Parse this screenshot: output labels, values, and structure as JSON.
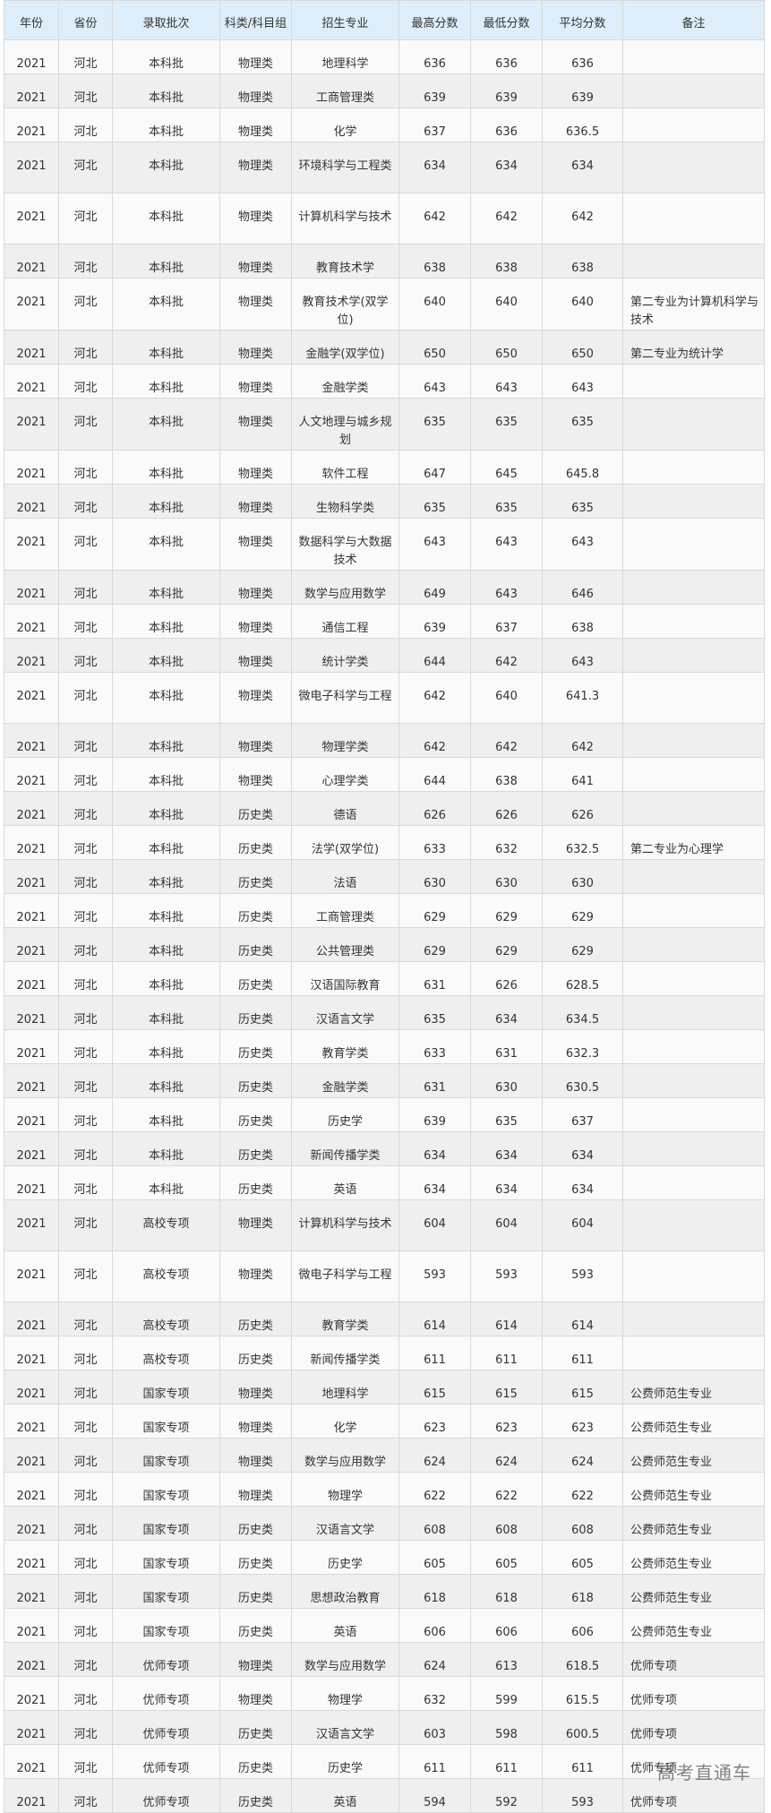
{
  "table": {
    "headers": [
      "年份",
      "省份",
      "录取批次",
      "科类/科目组",
      "招生专业",
      "最高分数",
      "最低分数",
      "平均分数",
      "备注"
    ],
    "rows": [
      [
        "2021",
        "河北",
        "本科批",
        "物理类",
        "地理科学",
        "636",
        "636",
        "636",
        ""
      ],
      [
        "2021",
        "河北",
        "本科批",
        "物理类",
        "工商管理类",
        "639",
        "639",
        "639",
        ""
      ],
      [
        "2021",
        "河北",
        "本科批",
        "物理类",
        "化学",
        "637",
        "636",
        "636.5",
        ""
      ],
      [
        "2021",
        "河北",
        "本科批",
        "物理类",
        "环境科学与工程类",
        "634",
        "634",
        "634",
        ""
      ],
      [
        "2021",
        "河北",
        "本科批",
        "物理类",
        "计算机科学与技术",
        "642",
        "642",
        "642",
        ""
      ],
      [
        "2021",
        "河北",
        "本科批",
        "物理类",
        "教育技术学",
        "638",
        "638",
        "638",
        ""
      ],
      [
        "2021",
        "河北",
        "本科批",
        "物理类",
        "教育技术学(双学位)",
        "640",
        "640",
        "640",
        "第二专业为计算机科学与技术"
      ],
      [
        "2021",
        "河北",
        "本科批",
        "物理类",
        "金融学(双学位)",
        "650",
        "650",
        "650",
        "第二专业为统计学"
      ],
      [
        "2021",
        "河北",
        "本科批",
        "物理类",
        "金融学类",
        "643",
        "643",
        "643",
        ""
      ],
      [
        "2021",
        "河北",
        "本科批",
        "物理类",
        "人文地理与城乡规划",
        "635",
        "635",
        "635",
        ""
      ],
      [
        "2021",
        "河北",
        "本科批",
        "物理类",
        "软件工程",
        "647",
        "645",
        "645.8",
        ""
      ],
      [
        "2021",
        "河北",
        "本科批",
        "物理类",
        "生物科学类",
        "635",
        "635",
        "635",
        ""
      ],
      [
        "2021",
        "河北",
        "本科批",
        "物理类",
        "数据科学与大数据技术",
        "643",
        "643",
        "643",
        ""
      ],
      [
        "2021",
        "河北",
        "本科批",
        "物理类",
        "数学与应用数学",
        "649",
        "643",
        "646",
        ""
      ],
      [
        "2021",
        "河北",
        "本科批",
        "物理类",
        "通信工程",
        "639",
        "637",
        "638",
        ""
      ],
      [
        "2021",
        "河北",
        "本科批",
        "物理类",
        "统计学类",
        "644",
        "642",
        "643",
        ""
      ],
      [
        "2021",
        "河北",
        "本科批",
        "物理类",
        "微电子科学与工程",
        "642",
        "640",
        "641.3",
        ""
      ],
      [
        "2021",
        "河北",
        "本科批",
        "物理类",
        "物理学类",
        "642",
        "642",
        "642",
        ""
      ],
      [
        "2021",
        "河北",
        "本科批",
        "物理类",
        "心理学类",
        "644",
        "638",
        "641",
        ""
      ],
      [
        "2021",
        "河北",
        "本科批",
        "历史类",
        "德语",
        "626",
        "626",
        "626",
        ""
      ],
      [
        "2021",
        "河北",
        "本科批",
        "历史类",
        "法学(双学位)",
        "633",
        "632",
        "632.5",
        "第二专业为心理学"
      ],
      [
        "2021",
        "河北",
        "本科批",
        "历史类",
        "法语",
        "630",
        "630",
        "630",
        ""
      ],
      [
        "2021",
        "河北",
        "本科批",
        "历史类",
        "工商管理类",
        "629",
        "629",
        "629",
        ""
      ],
      [
        "2021",
        "河北",
        "本科批",
        "历史类",
        "公共管理类",
        "629",
        "629",
        "629",
        ""
      ],
      [
        "2021",
        "河北",
        "本科批",
        "历史类",
        "汉语国际教育",
        "631",
        "626",
        "628.5",
        ""
      ],
      [
        "2021",
        "河北",
        "本科批",
        "历史类",
        "汉语言文学",
        "635",
        "634",
        "634.5",
        ""
      ],
      [
        "2021",
        "河北",
        "本科批",
        "历史类",
        "教育学类",
        "633",
        "631",
        "632.3",
        ""
      ],
      [
        "2021",
        "河北",
        "本科批",
        "历史类",
        "金融学类",
        "631",
        "630",
        "630.5",
        ""
      ],
      [
        "2021",
        "河北",
        "本科批",
        "历史类",
        "历史学",
        "639",
        "635",
        "637",
        ""
      ],
      [
        "2021",
        "河北",
        "本科批",
        "历史类",
        "新闻传播学类",
        "634",
        "634",
        "634",
        ""
      ],
      [
        "2021",
        "河北",
        "本科批",
        "历史类",
        "英语",
        "634",
        "634",
        "634",
        ""
      ],
      [
        "2021",
        "河北",
        "高校专项",
        "物理类",
        "计算机科学与技术",
        "604",
        "604",
        "604",
        ""
      ],
      [
        "2021",
        "河北",
        "高校专项",
        "物理类",
        "微电子科学与工程",
        "593",
        "593",
        "593",
        ""
      ],
      [
        "2021",
        "河北",
        "高校专项",
        "历史类",
        "教育学类",
        "614",
        "614",
        "614",
        ""
      ],
      [
        "2021",
        "河北",
        "高校专项",
        "历史类",
        "新闻传播学类",
        "611",
        "611",
        "611",
        ""
      ],
      [
        "2021",
        "河北",
        "国家专项",
        "物理类",
        "地理科学",
        "615",
        "615",
        "615",
        "公费师范生专业"
      ],
      [
        "2021",
        "河北",
        "国家专项",
        "物理类",
        "化学",
        "623",
        "623",
        "623",
        "公费师范生专业"
      ],
      [
        "2021",
        "河北",
        "国家专项",
        "物理类",
        "数学与应用数学",
        "624",
        "624",
        "624",
        "公费师范生专业"
      ],
      [
        "2021",
        "河北",
        "国家专项",
        "物理类",
        "物理学",
        "622",
        "622",
        "622",
        "公费师范生专业"
      ],
      [
        "2021",
        "河北",
        "国家专项",
        "历史类",
        "汉语言文学",
        "608",
        "608",
        "608",
        "公费师范生专业"
      ],
      [
        "2021",
        "河北",
        "国家专项",
        "历史类",
        "历史学",
        "605",
        "605",
        "605",
        "公费师范生专业"
      ],
      [
        "2021",
        "河北",
        "国家专项",
        "历史类",
        "思想政治教育",
        "618",
        "618",
        "618",
        "公费师范生专业"
      ],
      [
        "2021",
        "河北",
        "国家专项",
        "历史类",
        "英语",
        "606",
        "606",
        "606",
        "公费师范生专业"
      ],
      [
        "2021",
        "河北",
        "优师专项",
        "物理类",
        "数学与应用数学",
        "624",
        "613",
        "618.5",
        "优师专项"
      ],
      [
        "2021",
        "河北",
        "优师专项",
        "物理类",
        "物理学",
        "632",
        "599",
        "615.5",
        "优师专项"
      ],
      [
        "2021",
        "河北",
        "优师专项",
        "历史类",
        "汉语言文学",
        "603",
        "598",
        "600.5",
        "优师专项"
      ],
      [
        "2021",
        "河北",
        "优师专项",
        "历史类",
        "历史学",
        "611",
        "611",
        "611",
        "优师专项"
      ],
      [
        "2021",
        "河北",
        "优师专项",
        "历史类",
        "英语",
        "594",
        "592",
        "593",
        "优师专项"
      ]
    ]
  },
  "watermark": "高考直通车"
}
